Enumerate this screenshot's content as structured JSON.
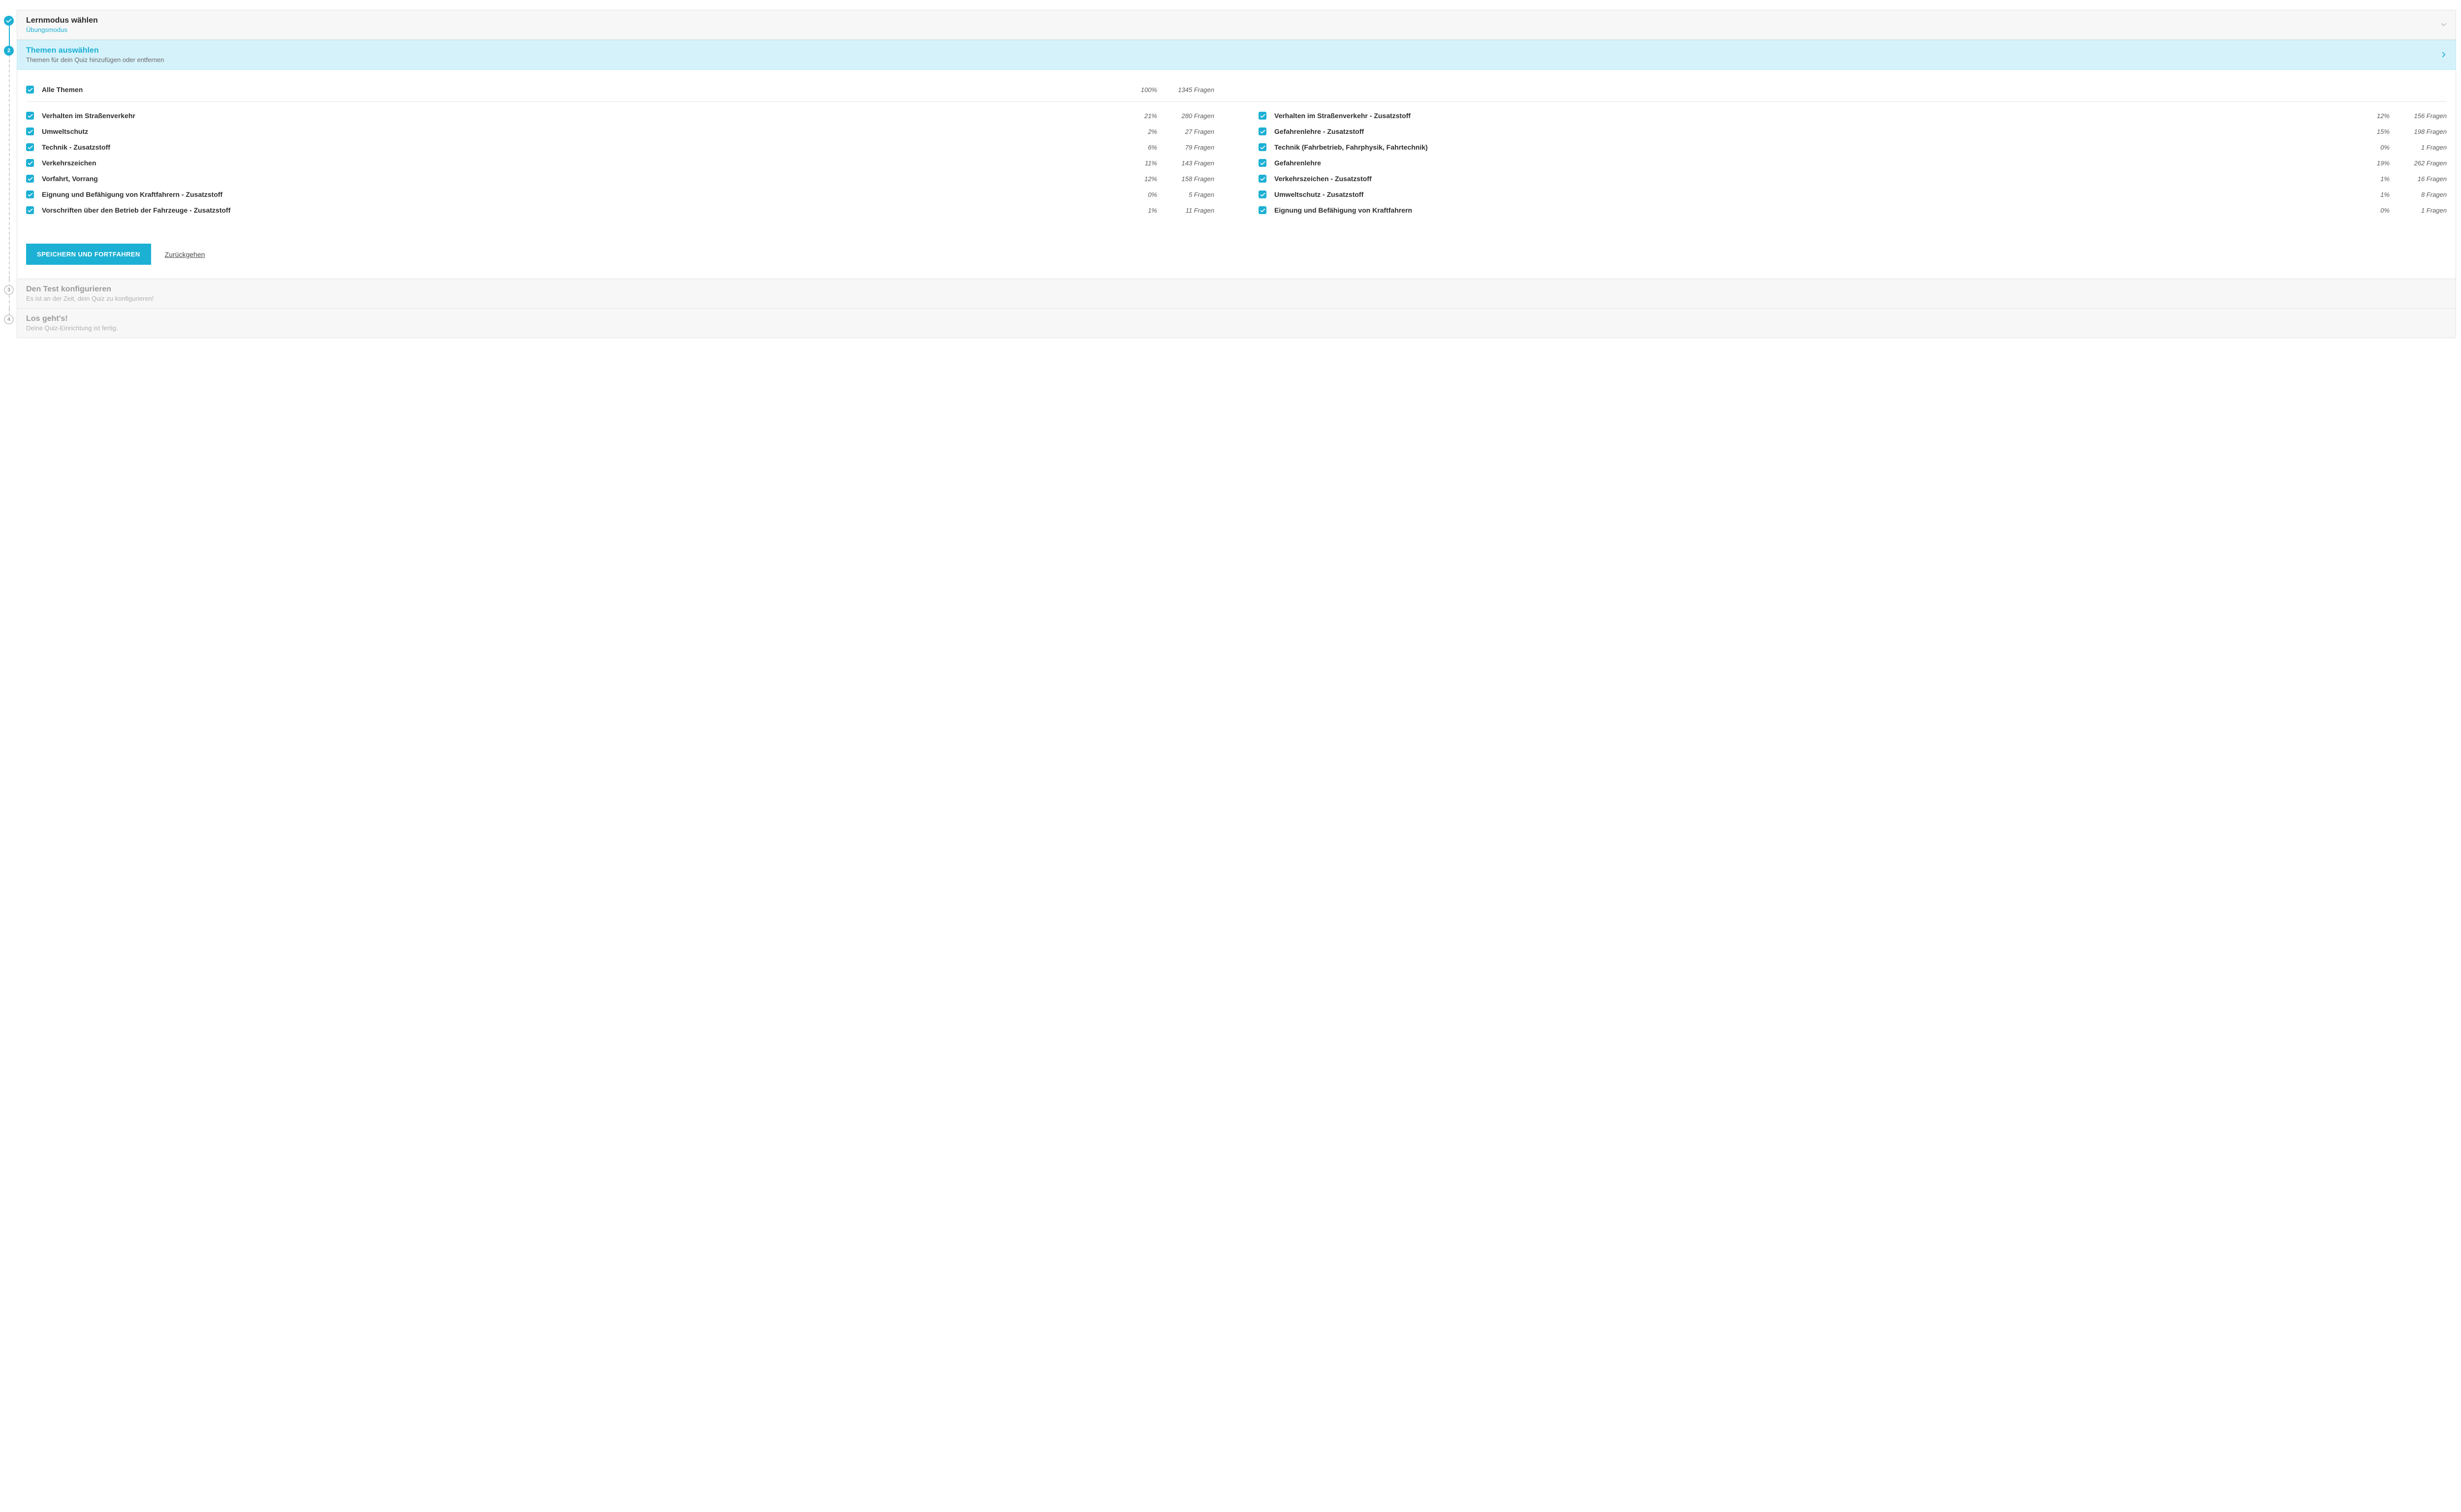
{
  "steps": {
    "s1": {
      "title": "Lernmodus wählen",
      "subtitle": "Übungsmodus"
    },
    "s2": {
      "title": "Themen auswählen",
      "subtitle": "Themen für dein Quiz hinzufügen oder entfernen",
      "number": "2"
    },
    "s3": {
      "title": "Den Test konfigurieren",
      "subtitle": "Es ist an der Zeit, dein Quiz zu konfigurieren!",
      "number": "3"
    },
    "s4": {
      "title": "Los geht's!",
      "subtitle": "Deine Quiz-Einrichtung ist fertig.",
      "number": "4"
    }
  },
  "all": {
    "label": "Alle Themen",
    "pct": "100%",
    "count": "1345 Fragen"
  },
  "left": [
    {
      "label": "Verhalten im Straßenverkehr",
      "pct": "21%",
      "count": "280 Fragen"
    },
    {
      "label": "Umweltschutz",
      "pct": "2%",
      "count": "27 Fragen"
    },
    {
      "label": "Technik - Zusatzstoff",
      "pct": "6%",
      "count": "79 Fragen"
    },
    {
      "label": "Verkehrszeichen",
      "pct": "11%",
      "count": "143 Fragen"
    },
    {
      "label": "Vorfahrt, Vorrang",
      "pct": "12%",
      "count": "158 Fragen"
    },
    {
      "label": "Eignung und Befähigung von Kraftfahrern - Zusatzstoff",
      "pct": "0%",
      "count": "5 Fragen"
    },
    {
      "label": "Vorschriften über den Betrieb der Fahrzeuge - Zusatzstoff",
      "pct": "1%",
      "count": "11 Fragen"
    }
  ],
  "right": [
    {
      "label": "Verhalten im Straßenverkehr - Zusatzstoff",
      "pct": "12%",
      "count": "156 Fragen"
    },
    {
      "label": "Gefahrenlehre - Zusatzstoff",
      "pct": "15%",
      "count": "198 Fragen"
    },
    {
      "label": "Technik (Fahrbetrieb, Fahrphysik, Fahrtechnik)",
      "pct": "0%",
      "count": "1 Fragen"
    },
    {
      "label": "Gefahrenlehre",
      "pct": "19%",
      "count": "262 Fragen"
    },
    {
      "label": "Verkehrszeichen - Zusatzstoff",
      "pct": "1%",
      "count": "16 Fragen"
    },
    {
      "label": "Umweltschutz - Zusatzstoff",
      "pct": "1%",
      "count": "8 Fragen"
    },
    {
      "label": "Eignung und Befähigung von Kraftfahrern",
      "pct": "0%",
      "count": "1 Fragen"
    }
  ],
  "actions": {
    "primary": "SPEICHERN UND FORTFAHREN",
    "back": "Zurückgehen"
  }
}
